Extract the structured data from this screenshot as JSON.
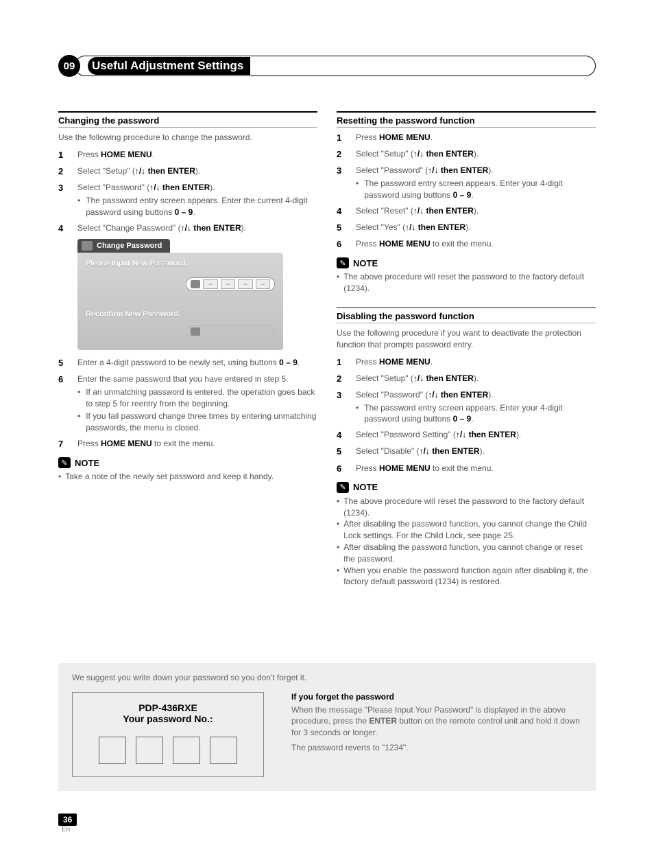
{
  "chapter_number": "09",
  "chapter_title": "Useful Adjustment Settings",
  "left": {
    "section_title": "Changing the password",
    "intro": "Use the following procedure to change the password.",
    "steps": {
      "s1_pre": "Press ",
      "s1_b": "HOME MENU",
      "s1_post": ".",
      "s2_pre": "Select \"Setup\" (",
      "s2_b": "ENTER",
      "s2_post": ").",
      "s3_pre": "Select \"Password\" (",
      "s3_b": "ENTER",
      "s3_post": ").",
      "s3_sub_a": "The password entry screen appears. Enter the current 4-digit password using buttons ",
      "s3_sub_b": "0 – 9",
      "s4_pre": "Select \"Change Password\" (",
      "s4_b": "ENTER",
      "s4_post": ").",
      "s5_pre": "Enter a 4-digit password to be newly set, using buttons ",
      "s5_b": "0 – 9",
      "s6": "Enter the same password that you have entered in step 5.",
      "s6_sub1": "If an unmatching password is entered, the operation goes back to step 5 for reentry from the beginning.",
      "s6_sub2": "If you fail password change three times by entering unmatching passwords, the menu is closed.",
      "s7_pre": "Press ",
      "s7_b": "HOME MENU",
      "s7_post": " to exit the menu."
    },
    "dialog": {
      "title": "Change Password",
      "label1": "Please Input New Password.",
      "label2": "Reconfirm New Password."
    },
    "note_label": "NOTE",
    "note_text": "Take a note of the newly set password and keep it handy."
  },
  "right": {
    "reset": {
      "title": "Resetting the password function",
      "s1_pre": "Press ",
      "s1_b": "HOME MENU",
      "s1_post": ".",
      "s2_pre": "Select \"Setup\" (",
      "s2_b": "ENTER",
      "s2_post": ").",
      "s3_pre": "Select \"Password\" (",
      "s3_b": "ENTER",
      "s3_post": ").",
      "s3_sub_a": "The password entry screen appears. Enter your 4-digit password using buttons ",
      "s3_sub_b": "0 – 9",
      "s4_pre": "Select \"Reset\" (",
      "s4_b": "ENTER",
      "s4_post": ").",
      "s5_pre": "Select \"Yes\" (",
      "s5_b": "ENTER",
      "s5_post": ").",
      "s6_pre": "Press ",
      "s6_b": "HOME MENU",
      "s6_post": " to exit the menu.",
      "note_label": "NOTE",
      "note_text": "The above procedure will reset the password to the factory default (1234)."
    },
    "disable": {
      "title": "Disabling the password function",
      "intro": "Use the following procedure if you want to deactivate the protection function that prompts password entry.",
      "s1_pre": "Press ",
      "s1_b": "HOME MENU",
      "s1_post": ".",
      "s2_pre": "Select \"Setup\" (",
      "s2_b": "ENTER",
      "s2_post": ").",
      "s3_pre": "Select \"Password\" (",
      "s3_b": "ENTER",
      "s3_post": ").",
      "s3_sub_a": "The password entry screen appears. Enter your 4-digit password using buttons ",
      "s3_sub_b": "0 – 9",
      "s4_pre": "Select \"Password Setting\" (",
      "s4_b": "ENTER",
      "s4_post": ").",
      "s5_pre": "Select \"Disable\" (",
      "s5_b": "ENTER",
      "s5_post": ").",
      "s6_pre": "Press ",
      "s6_b": "HOME MENU",
      "s6_post": " to exit the menu.",
      "note_label": "NOTE",
      "notes": {
        "n1": "The above procedure will reset the password to the factory default (1234).",
        "n2": "After disabling the password function, you cannot change the Child Lock settings. For the Child Lock, see page 25.",
        "n3": "After disabling the password function, you cannot change or reset the password.",
        "n4": "When you enable the password function again after disabling it, the factory default password (1234) is restored."
      }
    }
  },
  "bottom": {
    "suggest": "We suggest you write down your password so you don't forget it.",
    "card_title": "PDP-436RXE",
    "card_sub": "Your password No.:",
    "forgot_title": "If you forget the password",
    "forgot_body_pre": "When the message \"Please Input Your Password\" is displayed in the above procedure, press the ",
    "forgot_body_b": "ENTER",
    "forgot_body_post": " button on the remote control unit and hold it down for 3 seconds or longer.",
    "forgot_revert": "The password reverts to \"1234\"."
  },
  "page_number": "36",
  "page_lang": "En",
  "arrow_glyph": "↑/↓ then "
}
